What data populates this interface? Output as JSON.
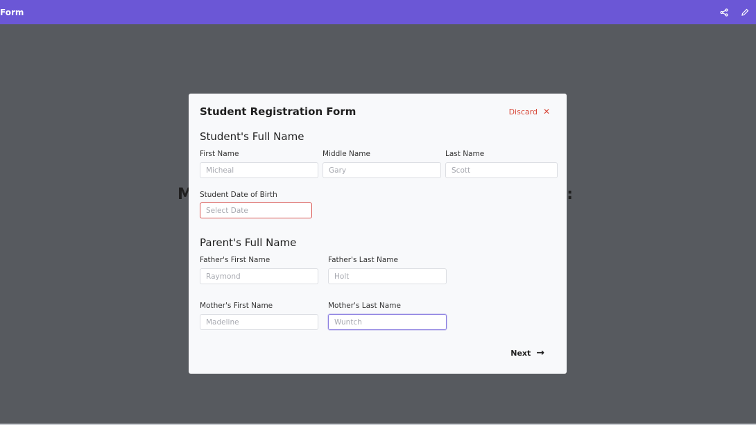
{
  "app": {
    "title": "Form",
    "icons": {
      "share": "share-icon",
      "edit": "pencil-icon"
    }
  },
  "background": {
    "heading_start": "M",
    "heading_end": ":"
  },
  "modal": {
    "title": "Student Registration Form",
    "discard_label": "Discard",
    "discard_icon": "✕",
    "student_section": {
      "title": "Student's Full Name",
      "first_name": {
        "label": "First Name",
        "placeholder": "Micheal"
      },
      "middle_name": {
        "label": "Middle Name",
        "placeholder": "Gary"
      },
      "last_name": {
        "label": "Last Name",
        "placeholder": "Scott"
      },
      "dob": {
        "label": "Student Date of Birth",
        "placeholder": "Select Date"
      }
    },
    "parent_section": {
      "title": "Parent's Full Name",
      "father_first": {
        "label": "Father's First Name",
        "placeholder": "Raymond"
      },
      "father_last": {
        "label": "Father's Last Name",
        "placeholder": "Holt"
      },
      "mother_first": {
        "label": "Mother's First Name",
        "placeholder": "Madeline"
      },
      "mother_last": {
        "label": "Mother's Last Name",
        "placeholder": "Wuntch"
      }
    },
    "next_label": "Next",
    "next_icon": "→"
  },
  "colors": {
    "topbar": "#6b57d6",
    "discard": "#d84a3b",
    "error_border": "#d9534f",
    "focus_border": "#8a7ee0"
  }
}
